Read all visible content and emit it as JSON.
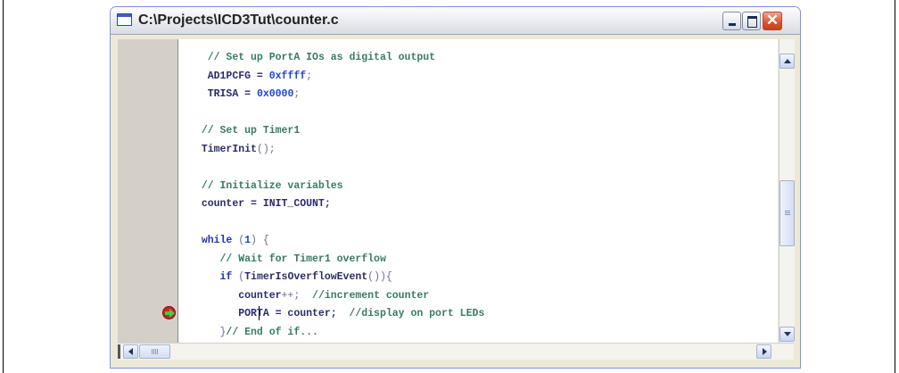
{
  "window": {
    "title": "C:\\Projects\\ICD3Tut\\counter.c",
    "close_glyph": "✕"
  },
  "colors": {
    "code_text": "#2b2b6b",
    "comment": "#3a7a64",
    "number": "#2045d0",
    "gutter": "#d4d0c8",
    "breakpoint_red": "#d61f1f",
    "exec_arrow_green": "#39d04a"
  },
  "icons": {
    "document": "document-icon",
    "minimize": "minimize-icon",
    "maximize": "maximize-icon",
    "close": "close-icon",
    "breakpoint": "breakpoint-execution-arrow-icon"
  },
  "code": {
    "lines": [
      {
        "indent": "   ",
        "segments": [
          {
            "t": "// Set up PortA IOs as digital output",
            "c": "cmt"
          }
        ]
      },
      {
        "indent": "   ",
        "segments": [
          {
            "t": "AD1PCFG = ",
            "c": ""
          },
          {
            "t": "0xffff",
            "c": "num"
          },
          {
            "t": ";",
            "c": "sym"
          }
        ]
      },
      {
        "indent": "   ",
        "segments": [
          {
            "t": "TRISA = ",
            "c": ""
          },
          {
            "t": "0x0000",
            "c": "num"
          },
          {
            "t": ";",
            "c": "sym"
          }
        ]
      },
      {
        "indent": "",
        "segments": []
      },
      {
        "indent": "  ",
        "segments": [
          {
            "t": "// Set up Timer1",
            "c": "cmt"
          }
        ]
      },
      {
        "indent": "  ",
        "segments": [
          {
            "t": "TimerInit",
            "c": ""
          },
          {
            "t": "();",
            "c": "sym"
          }
        ]
      },
      {
        "indent": "",
        "segments": []
      },
      {
        "indent": "  ",
        "segments": [
          {
            "t": "// Initialize variables",
            "c": "cmt"
          }
        ]
      },
      {
        "indent": "  ",
        "segments": [
          {
            "t": "counter = INIT_COUNT;",
            "c": ""
          }
        ]
      },
      {
        "indent": "",
        "segments": []
      },
      {
        "indent": "  ",
        "segments": [
          {
            "t": "while",
            "c": "kw"
          },
          {
            "t": " (",
            "c": "sym"
          },
          {
            "t": "1",
            "c": "num"
          },
          {
            "t": ") {",
            "c": "sym"
          }
        ]
      },
      {
        "indent": "     ",
        "segments": [
          {
            "t": "// Wait for Timer1 overflow",
            "c": "cmt"
          }
        ]
      },
      {
        "indent": "     ",
        "segments": [
          {
            "t": "if",
            "c": "kw"
          },
          {
            "t": " (",
            "c": "sym"
          },
          {
            "t": "TimerIsOverflowEvent",
            "c": ""
          },
          {
            "t": "()){",
            "c": "sym"
          }
        ]
      },
      {
        "indent": "        ",
        "segments": [
          {
            "t": "counter",
            "c": ""
          },
          {
            "t": "++;",
            "c": "sym"
          },
          {
            "t": "  //increment counter",
            "c": "cmt"
          }
        ]
      },
      {
        "indent": "        ",
        "segments": [
          {
            "t": "PORTA = counter;",
            "c": ""
          },
          {
            "t": "  //display on port LEDs",
            "c": "cmt"
          }
        ]
      },
      {
        "indent": "     ",
        "segments": [
          {
            "t": "}",
            "c": "sym"
          },
          {
            "t": "// End of if...",
            "c": "cmt"
          }
        ]
      }
    ]
  }
}
